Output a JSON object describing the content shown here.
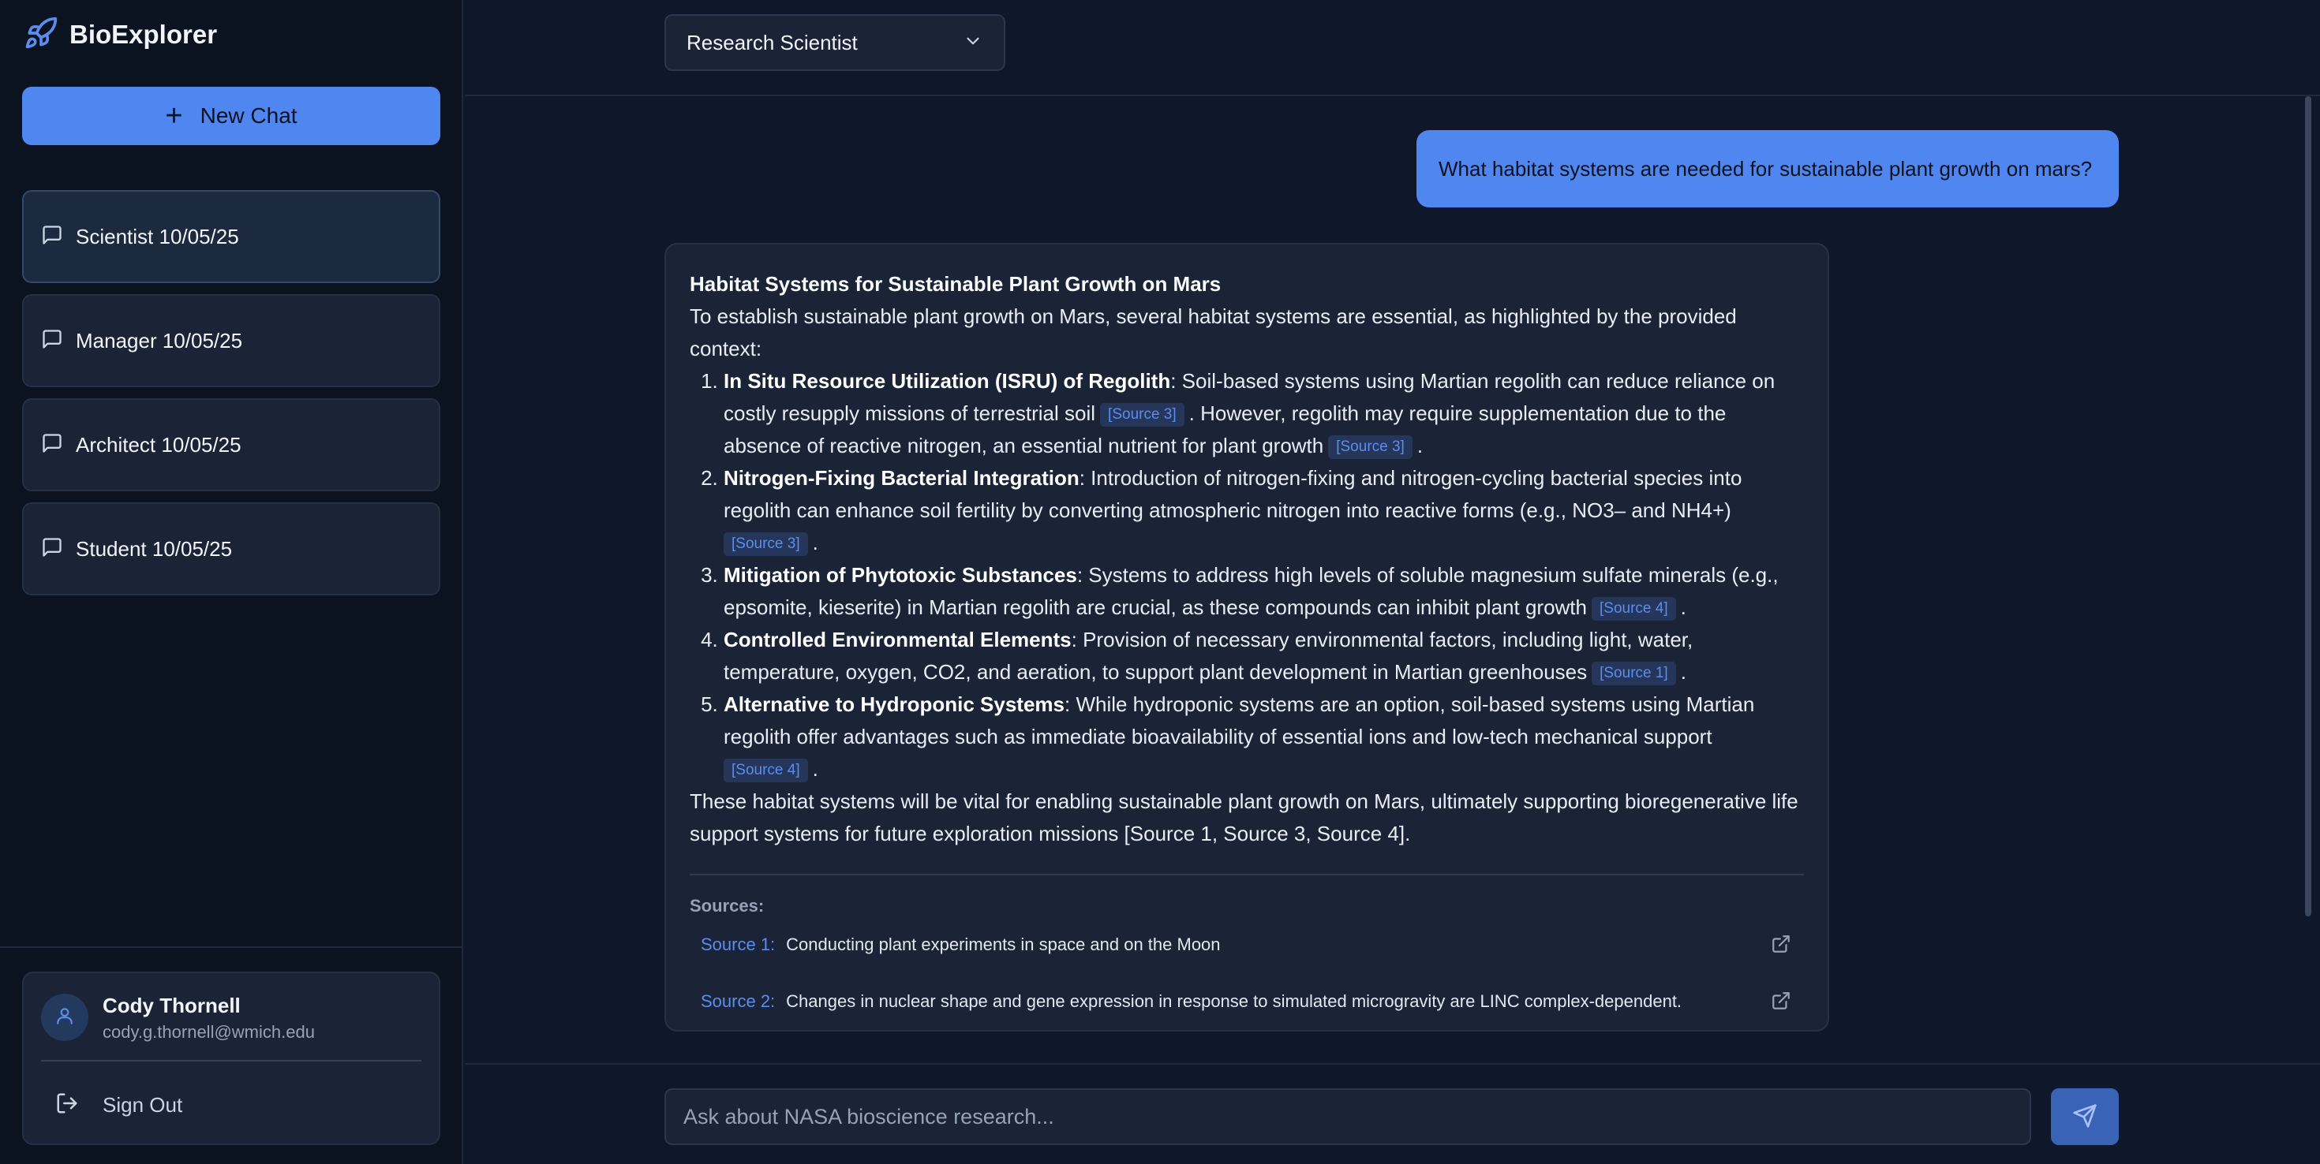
{
  "app": {
    "name": "BioExplorer",
    "logo_icon": "rocket-icon",
    "accent": "#4f86f0"
  },
  "sidebar": {
    "new_chat_label": "New Chat",
    "chats": [
      {
        "label": "Scientist 10/05/25",
        "active": true
      },
      {
        "label": "Manager 10/05/25",
        "active": false
      },
      {
        "label": "Architect 10/05/25",
        "active": false
      },
      {
        "label": "Student 10/05/25",
        "active": false
      }
    ],
    "user": {
      "name": "Cody Thornell",
      "email": "cody.g.thornell@wmich.edu"
    },
    "sign_out_label": "Sign Out"
  },
  "header": {
    "role": "Research Scientist"
  },
  "conversation": {
    "user_message": "What habitat systems are needed for sustainable plant growth on mars?",
    "answer": {
      "title": "Habitat Systems for Sustainable Plant Growth on Mars",
      "intro": "To establish sustainable plant growth on Mars, several habitat systems are essential, as highlighted by the provided context:",
      "items": [
        {
          "heading": "In Situ Resource Utilization (ISRU) of Regolith",
          "text_a": ": Soil-based systems using Martian regolith can reduce reliance on costly resupply missions of terrestrial soil",
          "cite_a": "[Source 3]",
          "text_b": ". However, regolith may require supplementation due to the absence of reactive nitrogen, an essential nutrient for plant growth",
          "cite_b": "[Source 3]",
          "text_c": "."
        },
        {
          "heading": "Nitrogen-Fixing Bacterial Integration",
          "text_a": ": Introduction of nitrogen-fixing and nitrogen-cycling bacterial species into regolith can enhance soil fertility by converting atmospheric nitrogen into reactive forms (e.g., NO3– and NH4+)",
          "cite_a": "[Source 3]",
          "text_b": "."
        },
        {
          "heading": "Mitigation of Phytotoxic Substances",
          "text_a": ": Systems to address high levels of soluble magnesium sulfate minerals (e.g., epsomite, kieserite) in Martian regolith are crucial, as these compounds can inhibit plant growth",
          "cite_a": "[Source 4]",
          "text_b": "."
        },
        {
          "heading": "Controlled Environmental Elements",
          "text_a": ": Provision of necessary environmental factors, including light, water, temperature, oxygen, CO2, and aeration, to support plant development in Martian greenhouses",
          "cite_a": "[Source 1]",
          "text_b": "."
        },
        {
          "heading": "Alternative to Hydroponic Systems",
          "text_a": ": While hydroponic systems are an option, soil-based systems using Martian regolith offer advantages such as immediate bioavailability of essential ions and low-tech mechanical support",
          "cite_a": "[Source 4]",
          "text_b": "."
        }
      ],
      "conclusion": "These habitat systems will be vital for enabling sustainable plant growth on Mars, ultimately supporting bioregenerative life support systems for future exploration missions [Source 1, Source 3, Source 4].",
      "sources_title": "Sources:",
      "sources": [
        {
          "label": "Source 1:",
          "title": "Conducting plant experiments in space and on the Moon"
        },
        {
          "label": "Source 2:",
          "title": "Changes in nuclear shape and gene expression in response to simulated microgravity are LINC complex-dependent."
        }
      ]
    }
  },
  "composer": {
    "placeholder": "Ask about NASA bioscience research..."
  }
}
